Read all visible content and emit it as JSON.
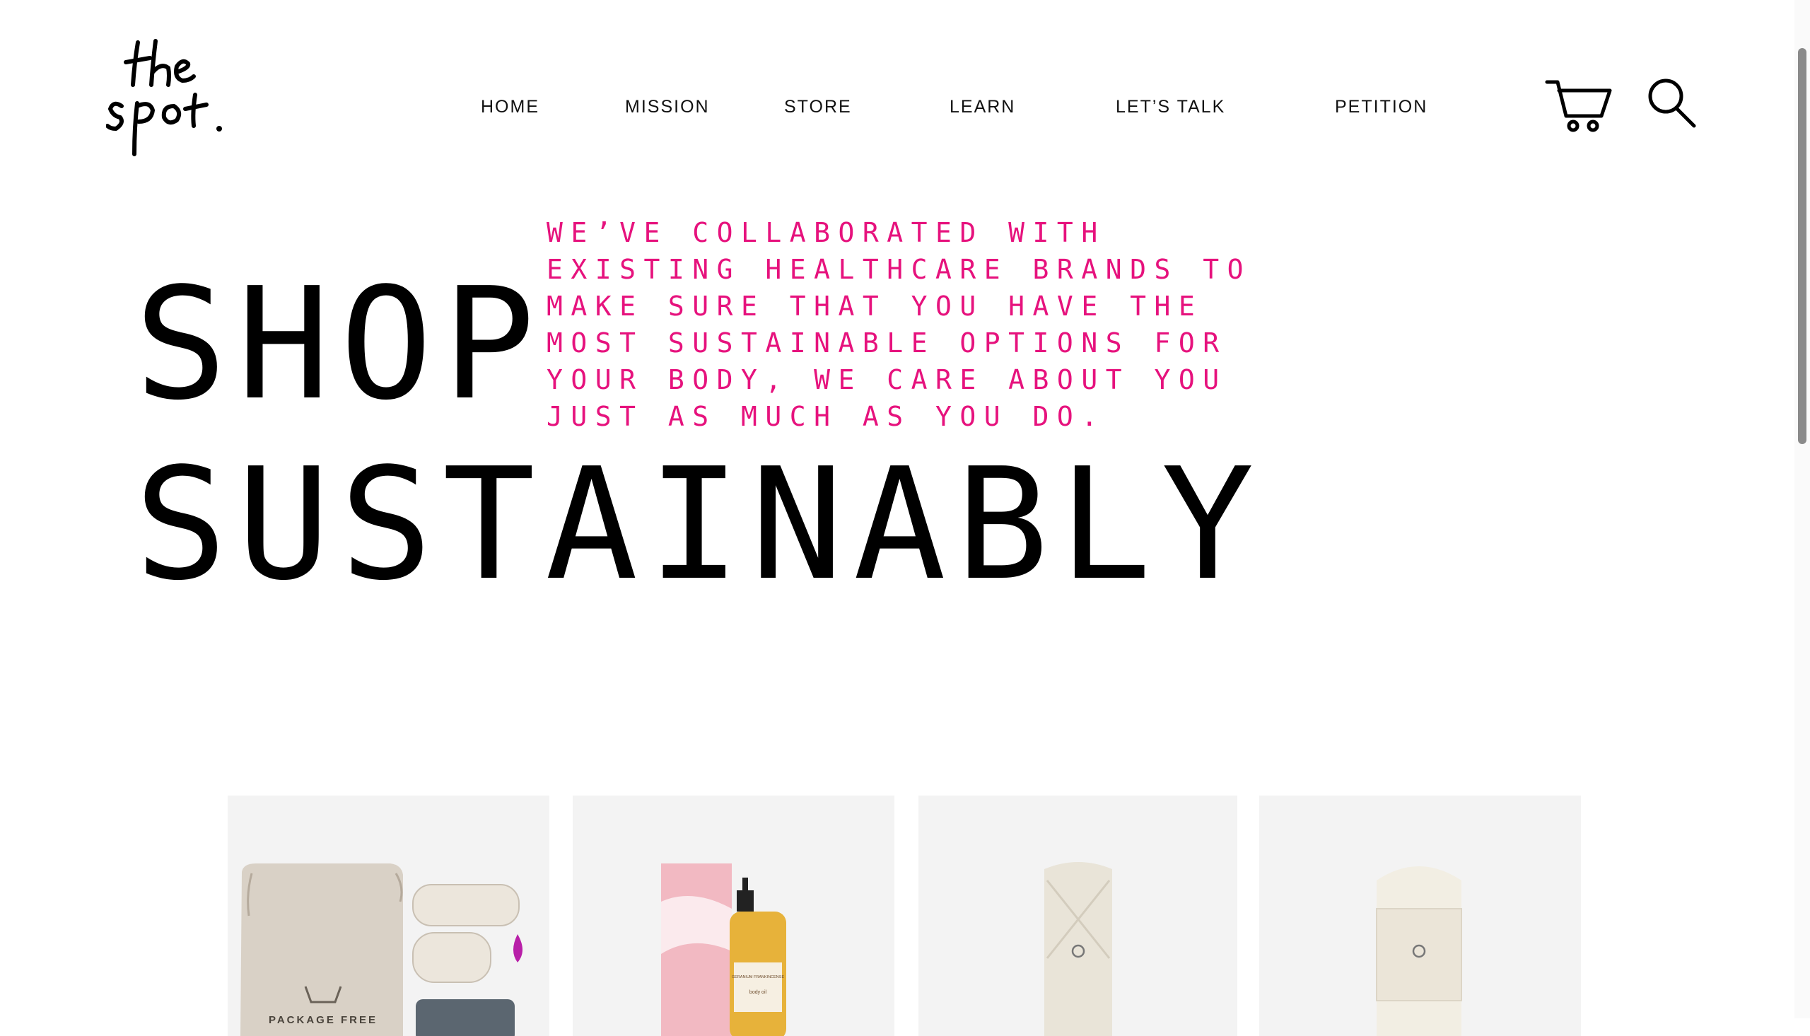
{
  "brand": {
    "logo_text": "the spot."
  },
  "nav": {
    "items": [
      {
        "label": "HOME"
      },
      {
        "label": "MISSION"
      },
      {
        "label": "STORE"
      },
      {
        "label": "LEARN"
      },
      {
        "label": "LET’S TALK"
      },
      {
        "label": "PETITION"
      }
    ],
    "icons": [
      "cart-icon",
      "search-icon"
    ]
  },
  "hero": {
    "title_line1": "SHOP",
    "title_line2": "SUSTAINABLY",
    "tagline": "WE’VE COLLABORATED WITH EXISTING HEALTHCARE BRANDS TO MAKE SURE THAT YOU HAVE THE MOST SUSTAINABLE OPTIONS FOR YOUR BODY, WE CARE ABOUT YOU JUST AS MUCH AS YOU DO."
  },
  "products": [
    {
      "image_label": "PACKAGE FREE"
    },
    {
      "image_label": "GERANIUM FRANKINCENSE",
      "image_sublabel": "body oil"
    },
    {
      "image_label": ""
    },
    {
      "image_label": ""
    }
  ],
  "colors": {
    "accent": "#e6127d",
    "text": "#000000",
    "card_bg": "#f3f3f3"
  }
}
